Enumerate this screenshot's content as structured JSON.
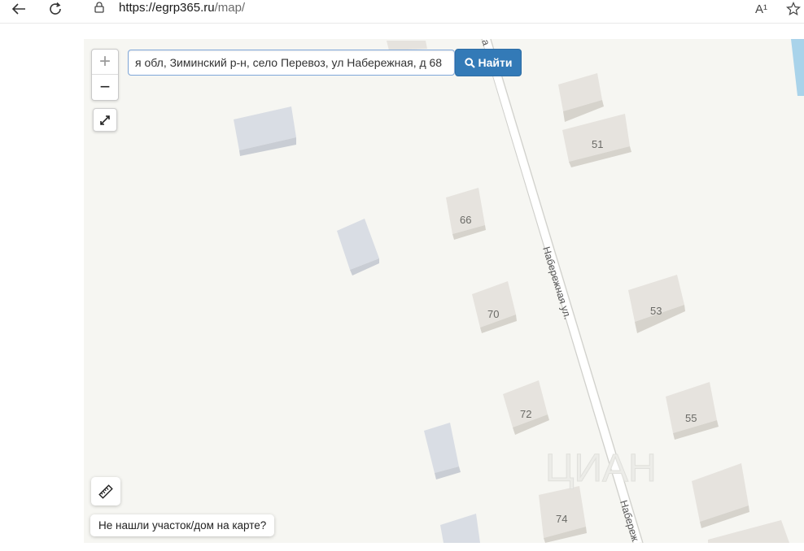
{
  "browser": {
    "url_host": "https://egrp365.ru",
    "url_path": "/map/",
    "reader_label": "A¹"
  },
  "search": {
    "value": "я обл, Зиминский р-н, село Перевоз, ул Набережная, д 68",
    "button_label": "Найти"
  },
  "map": {
    "zoom_in": "+",
    "zoom_out": "−",
    "street_name": "Набережная ул.",
    "street_name_partial": "Набереж",
    "street_name_top": "а",
    "house_numbers": [
      "51",
      "66",
      "70",
      "53",
      "72",
      "55",
      "74"
    ],
    "not_found_label": "Не нашли участок/дом на карте?",
    "watermark": "ЦИАН"
  },
  "colors": {
    "map_bg": "#f6f6f2",
    "building": "#e6e3de",
    "building_selected": "#d9dde4",
    "accent": "#337ab7",
    "water": "#a9d3ea"
  }
}
